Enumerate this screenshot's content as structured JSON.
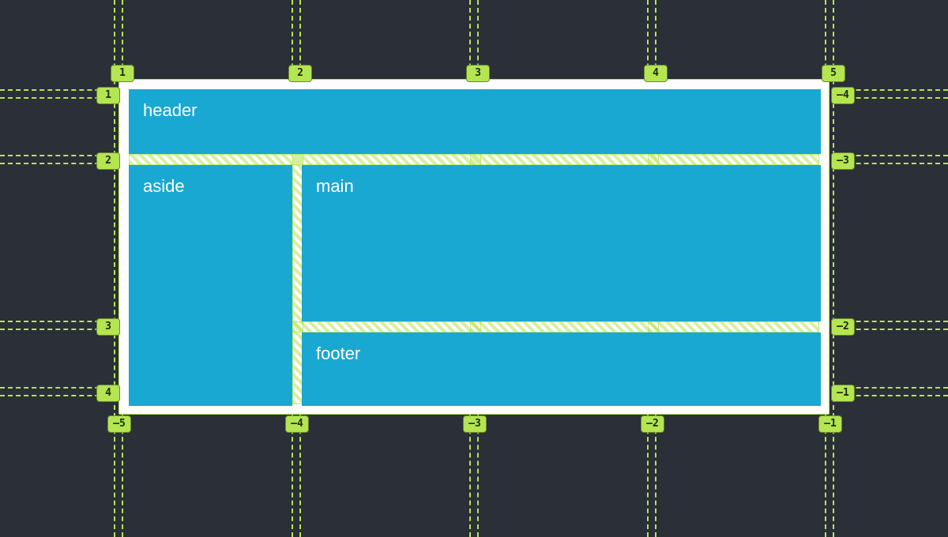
{
  "areas": {
    "header": "header",
    "aside": "aside",
    "main": "main",
    "footer": "footer"
  },
  "cols": {
    "top": [
      "1",
      "2",
      "3",
      "4",
      "5"
    ],
    "bottom": [
      "–5",
      "–4",
      "–3",
      "–2",
      "–1"
    ]
  },
  "rows": {
    "left": [
      "1",
      "2",
      "3",
      "4"
    ],
    "right": [
      "–4",
      "–3",
      "–2",
      "–1"
    ]
  }
}
